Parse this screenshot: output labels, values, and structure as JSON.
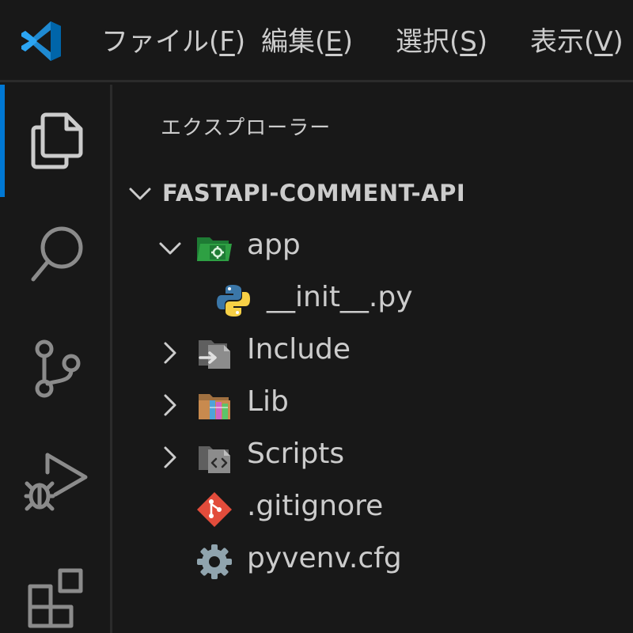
{
  "menu": {
    "items": [
      {
        "label": "ファイル(",
        "mnemonic": "F",
        "suffix": ")"
      },
      {
        "label": "編集(",
        "mnemonic": "E",
        "suffix": ")"
      },
      {
        "label": "選択(",
        "mnemonic": "S",
        "suffix": ")"
      },
      {
        "label": "表示(",
        "mnemonic": "V",
        "suffix": ")"
      }
    ]
  },
  "activity_bar": {
    "icons": [
      "files-icon",
      "search-icon",
      "source-control-icon",
      "run-debug-icon",
      "extensions-icon"
    ],
    "active": "files-icon",
    "accent_color": "#0078d4"
  },
  "explorer": {
    "title": "エクスプローラー",
    "project": {
      "name": "FASTAPI-COMMENT-API",
      "expanded": true
    },
    "tree": [
      {
        "label": "app",
        "type": "folder",
        "expanded": true,
        "icon": "folder-app-icon"
      },
      {
        "label": "__init__.py",
        "type": "file",
        "icon": "python-icon"
      },
      {
        "label": "Include",
        "type": "folder",
        "expanded": false,
        "icon": "folder-include-icon"
      },
      {
        "label": "Lib",
        "type": "folder",
        "expanded": false,
        "icon": "folder-lib-icon"
      },
      {
        "label": "Scripts",
        "type": "folder",
        "expanded": false,
        "icon": "folder-scripts-icon"
      },
      {
        "label": ".gitignore",
        "type": "file",
        "icon": "git-icon"
      },
      {
        "label": "pyvenv.cfg",
        "type": "file",
        "icon": "gear-config-icon"
      }
    ]
  },
  "colors": {
    "background": "#181818",
    "text": "#cccccc",
    "border": "#2b2b2b",
    "accent": "#0078d4"
  }
}
